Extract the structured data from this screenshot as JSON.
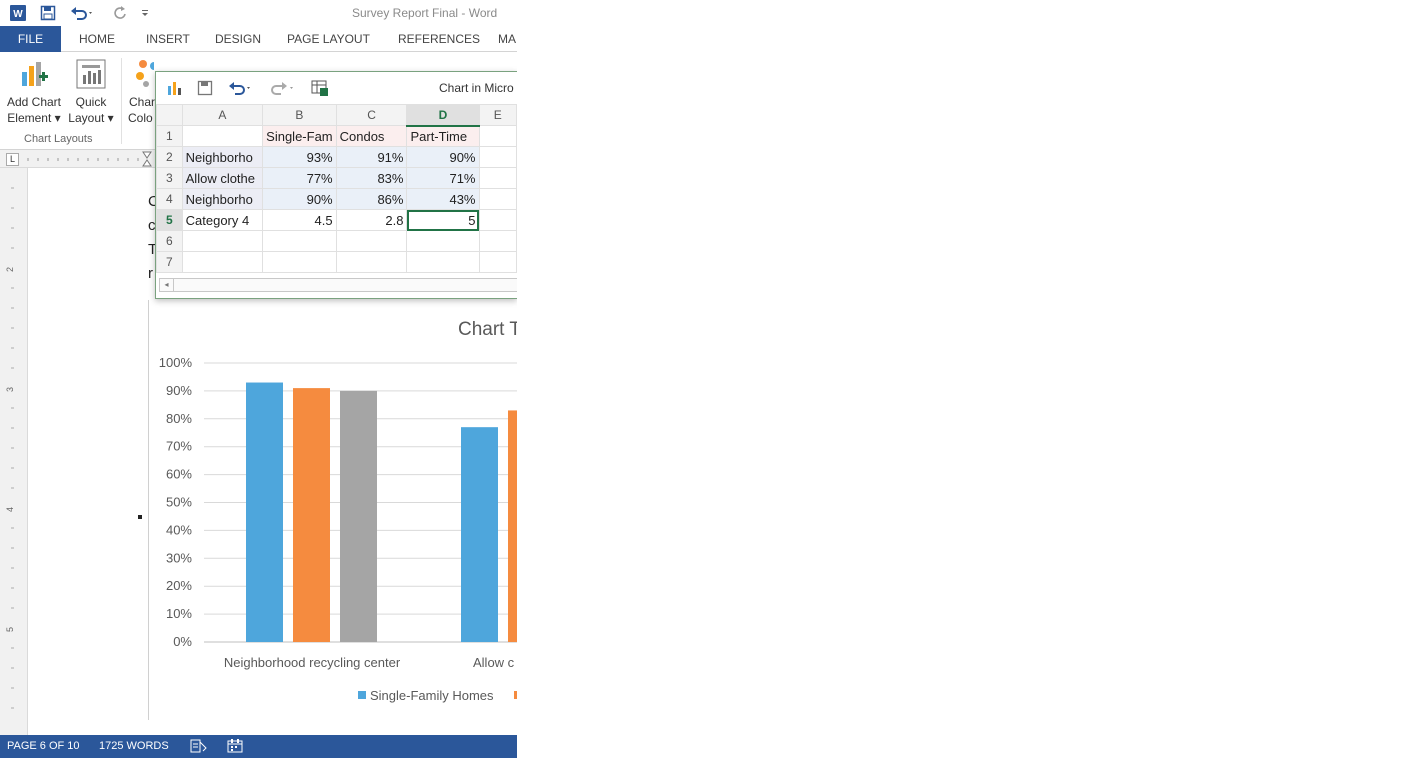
{
  "window": {
    "title": "Survey Report Final - Word",
    "app_icon": "word-icon",
    "qat": [
      "save-icon",
      "undo-icon",
      "redo-icon",
      "customize-qat-icon"
    ]
  },
  "ribbon": {
    "tabs": [
      "FILE",
      "HOME",
      "INSERT",
      "DESIGN",
      "PAGE LAYOUT",
      "REFERENCES",
      "MA"
    ],
    "buttons": {
      "add_chart_element": [
        "Add Chart",
        "Element ▾"
      ],
      "quick_layout": [
        "Quick",
        "Layout ▾"
      ],
      "change_colors": [
        "Char",
        "Colo"
      ]
    },
    "group_label": "Chart Layouts"
  },
  "document": {
    "letters": [
      "C",
      "c",
      "T",
      "r"
    ]
  },
  "data_window": {
    "title": "Chart in Micro",
    "columns": [
      "A",
      "B",
      "C",
      "D",
      "E"
    ],
    "rows": [
      {
        "n": "1",
        "a": "",
        "b": "Single-Fam",
        "c": "Condos",
        "d": "Part-Time"
      },
      {
        "n": "2",
        "a": "Neighborho",
        "b": "93%",
        "c": "91%",
        "d": "90%"
      },
      {
        "n": "3",
        "a": "Allow clothe",
        "b": "77%",
        "c": "83%",
        "d": "71%"
      },
      {
        "n": "4",
        "a": "Neighborho",
        "b": "90%",
        "c": "86%",
        "d": "43%"
      },
      {
        "n": "5",
        "a": "Category 4",
        "b": "4.5",
        "c": "2.8",
        "d": "5"
      },
      {
        "n": "6",
        "a": "",
        "b": "",
        "c": "",
        "d": ""
      },
      {
        "n": "7",
        "a": "",
        "b": "",
        "c": "",
        "d": ""
      }
    ]
  },
  "chart_data": {
    "type": "bar",
    "title": "Chart T",
    "categories": [
      "Neighborhood recycling center",
      "Allow c"
    ],
    "series": [
      {
        "name": "Single-Family Homes",
        "color": "#4ea6dc",
        "values": [
          0.93,
          0.77
        ]
      },
      {
        "name": "",
        "color": "#f58b3f",
        "values": [
          0.91,
          0.83
        ]
      },
      {
        "name": "",
        "color": "#a5a5a5",
        "values": [
          0.9,
          null
        ]
      }
    ],
    "yticks": [
      "0%",
      "10%",
      "20%",
      "30%",
      "40%",
      "50%",
      "60%",
      "70%",
      "80%",
      "90%",
      "100%"
    ],
    "ylim": [
      0,
      1
    ],
    "grid": true,
    "legend": "bottom"
  },
  "status": {
    "page": "PAGE 6 OF 10",
    "words": "1725 WORDS",
    "proofing_icon": "proofing-icon",
    "macro_icon": "macro-icon"
  }
}
